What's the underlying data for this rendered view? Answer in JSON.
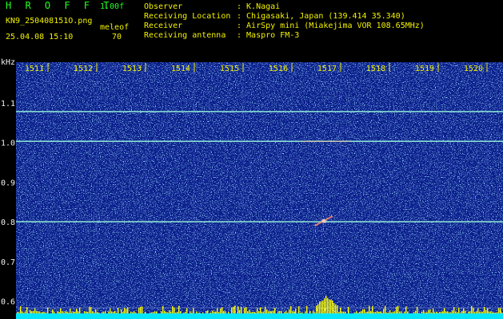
{
  "header": {
    "app_name": "H R O F F T",
    "version": "1.00f",
    "file_name": "KN9_250408151O.png",
    "datetime": "25.04.08 15:10",
    "meleof_label": "meleof",
    "meleof_value": "70",
    "info_labels": {
      "observer": "Observer",
      "location": "Receiving Location",
      "receiver": "Receiver",
      "antenna": "Receiving antenna"
    },
    "info_values": {
      "observer": ": K.Nagai",
      "location": ": Chigasaki, Japan (139.414 35.340)",
      "receiver": ": AirSpy mini (Miakejima VOR 108.65MHz)",
      "antenna": ": Maspro FM-3"
    }
  },
  "colors": {
    "background": "#000000",
    "plot_bg": "#0a1e8c",
    "text_yellow": "#f2f200",
    "text_white": "#f2f2f2",
    "text_green": "#22ff22",
    "signal_line": "#8ee8d6",
    "spectrum_bars": "#ffff00",
    "spectrum_base": "#00e6ff"
  },
  "chart_data": {
    "type": "heatmap",
    "ylabel": "kHz",
    "x_ticks": [
      "1511",
      "1512",
      "1513",
      "1514",
      "1515",
      "1516",
      "1517",
      "1518",
      "1519",
      "1520"
    ],
    "y_ticks": [
      "1.1",
      "1.0",
      "0.9",
      "0.8",
      "0.7",
      "0.6"
    ],
    "x_range": [
      1511,
      1520
    ],
    "y_range": [
      0.6,
      1.1
    ],
    "carriers_khz": [
      1.08,
      1.005,
      0.802
    ],
    "meteor_echo": {
      "time": 1516.7,
      "khz": 0.8
    },
    "spectrum_peak_time": 1516.7
  }
}
